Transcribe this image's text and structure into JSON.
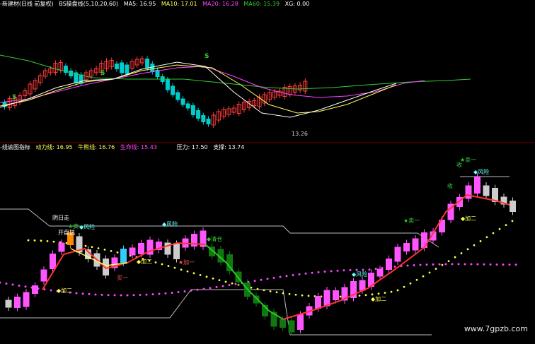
{
  "top_panel": {
    "title": "-新建材(日线 前复权)",
    "indicator": "BS操盘线(5,10,20,60)",
    "ma5": "MA5: 16.95",
    "ma10": "MA10: 17.01",
    "ma20": "MA20: 16.28",
    "ma60": "MA60: 15.39",
    "xg": "XG: 0.00",
    "low_price_label": "13.26",
    "signal_s": "S"
  },
  "bottom_panel": {
    "title": "-线谕图指标",
    "power_line": "动力线: 16.95",
    "bull_bear_line": "牛熊线: 16.76",
    "life_line": "生命线: 15.43",
    "pressure": "压力: 17.50",
    "support": "支撑: 13.74",
    "labels": {
      "sun_stairs": "阴日走",
      "open_start": "开盘选",
      "risk": "◆风险",
      "sell_one": "★卖一",
      "add_two": "◆加二",
      "buy_one": "买一",
      "add_one": "★加一",
      "qingcang": "◆清仓",
      "shou": "收",
      "shou2": "收"
    }
  },
  "watermark": "www.7gpzb.com",
  "colors": {
    "up": "#ff3a3a",
    "down": "#00cccc",
    "ma5": "#ffffff",
    "ma10": "#ffff55",
    "ma20": "#ff44ff",
    "ma60": "#33cc33",
    "bull": "#ff55ff",
    "bear": "#cccccc"
  }
}
